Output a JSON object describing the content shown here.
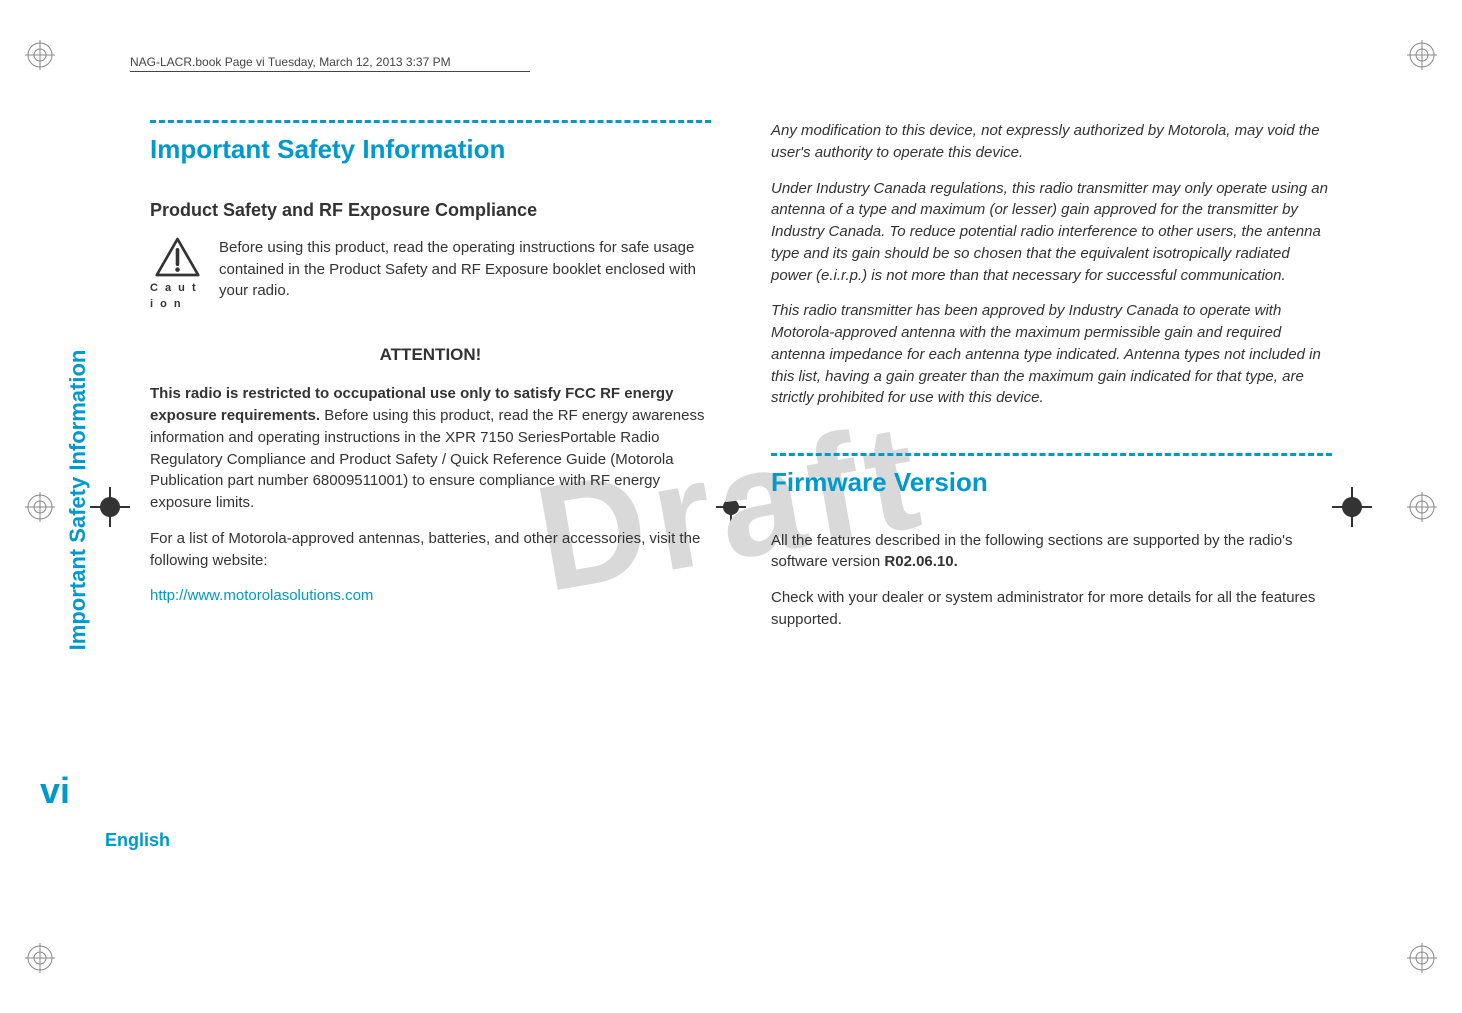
{
  "header": {
    "running_head": "NAG-LACR.book  Page vi  Tuesday, March 12, 2013  3:37 PM"
  },
  "watermark": "Draft",
  "sidebar": {
    "section_label": "Important Safety Information",
    "page_number": "vi",
    "language": "English"
  },
  "left_column": {
    "heading1": "Important Safety Information",
    "heading2": "Product Safety and RF Exposure Compliance",
    "caution_label": "C a u t i o n",
    "caution_text": "Before using this product, read the operating instructions for safe usage contained in the Product Safety and RF Exposure booklet enclosed with your radio.",
    "attention_heading": "ATTENTION!",
    "restricted_bold": "This radio is restricted to occupational use only to satisfy FCC RF energy exposure requirements.",
    "restricted_rest": " Before using this product, read the RF energy awareness information and operating instructions in the XPR 7150 SeriesPortable Radio Regulatory Compliance and Product Safety / Quick Reference Guide (Motorola Publication part number 68009511001) to ensure compliance with RF energy exposure limits.",
    "accessories_para": "For a list of Motorola-approved antennas, batteries, and other accessories, visit the following website:",
    "link_text": "http://www.motorolasolutions.com"
  },
  "right_column": {
    "mod_para": "Any modification to this device, not expressly authorized by Motorola, may void the user's authority to operate this device.",
    "ic_para": "Under Industry Canada regulations, this radio transmitter may only operate using an antenna of a type and maximum (or lesser) gain approved for the transmitter by Industry Canada. To reduce potential radio interference to other users, the antenna type and its gain should be so chosen that the equivalent isotropically radiated power (e.i.r.p.) is not more than that necessary for successful communication.",
    "approval_para": "This radio transmitter has been approved by Industry Canada to operate with Motorola-approved antenna with the maximum permissible gain and required antenna impedance for each antenna type indicated. Antenna types not included in this list, having a gain greater than the maximum gain indicated for that type, are strictly prohibited for use with this device.",
    "firmware_heading": "Firmware Version",
    "firmware_para_pre": "All the features described in the following sections are supported by the radio's software version ",
    "firmware_version": "R02.06.10.",
    "dealer_para": "Check with your dealer or system administrator for more details for all the features supported."
  }
}
